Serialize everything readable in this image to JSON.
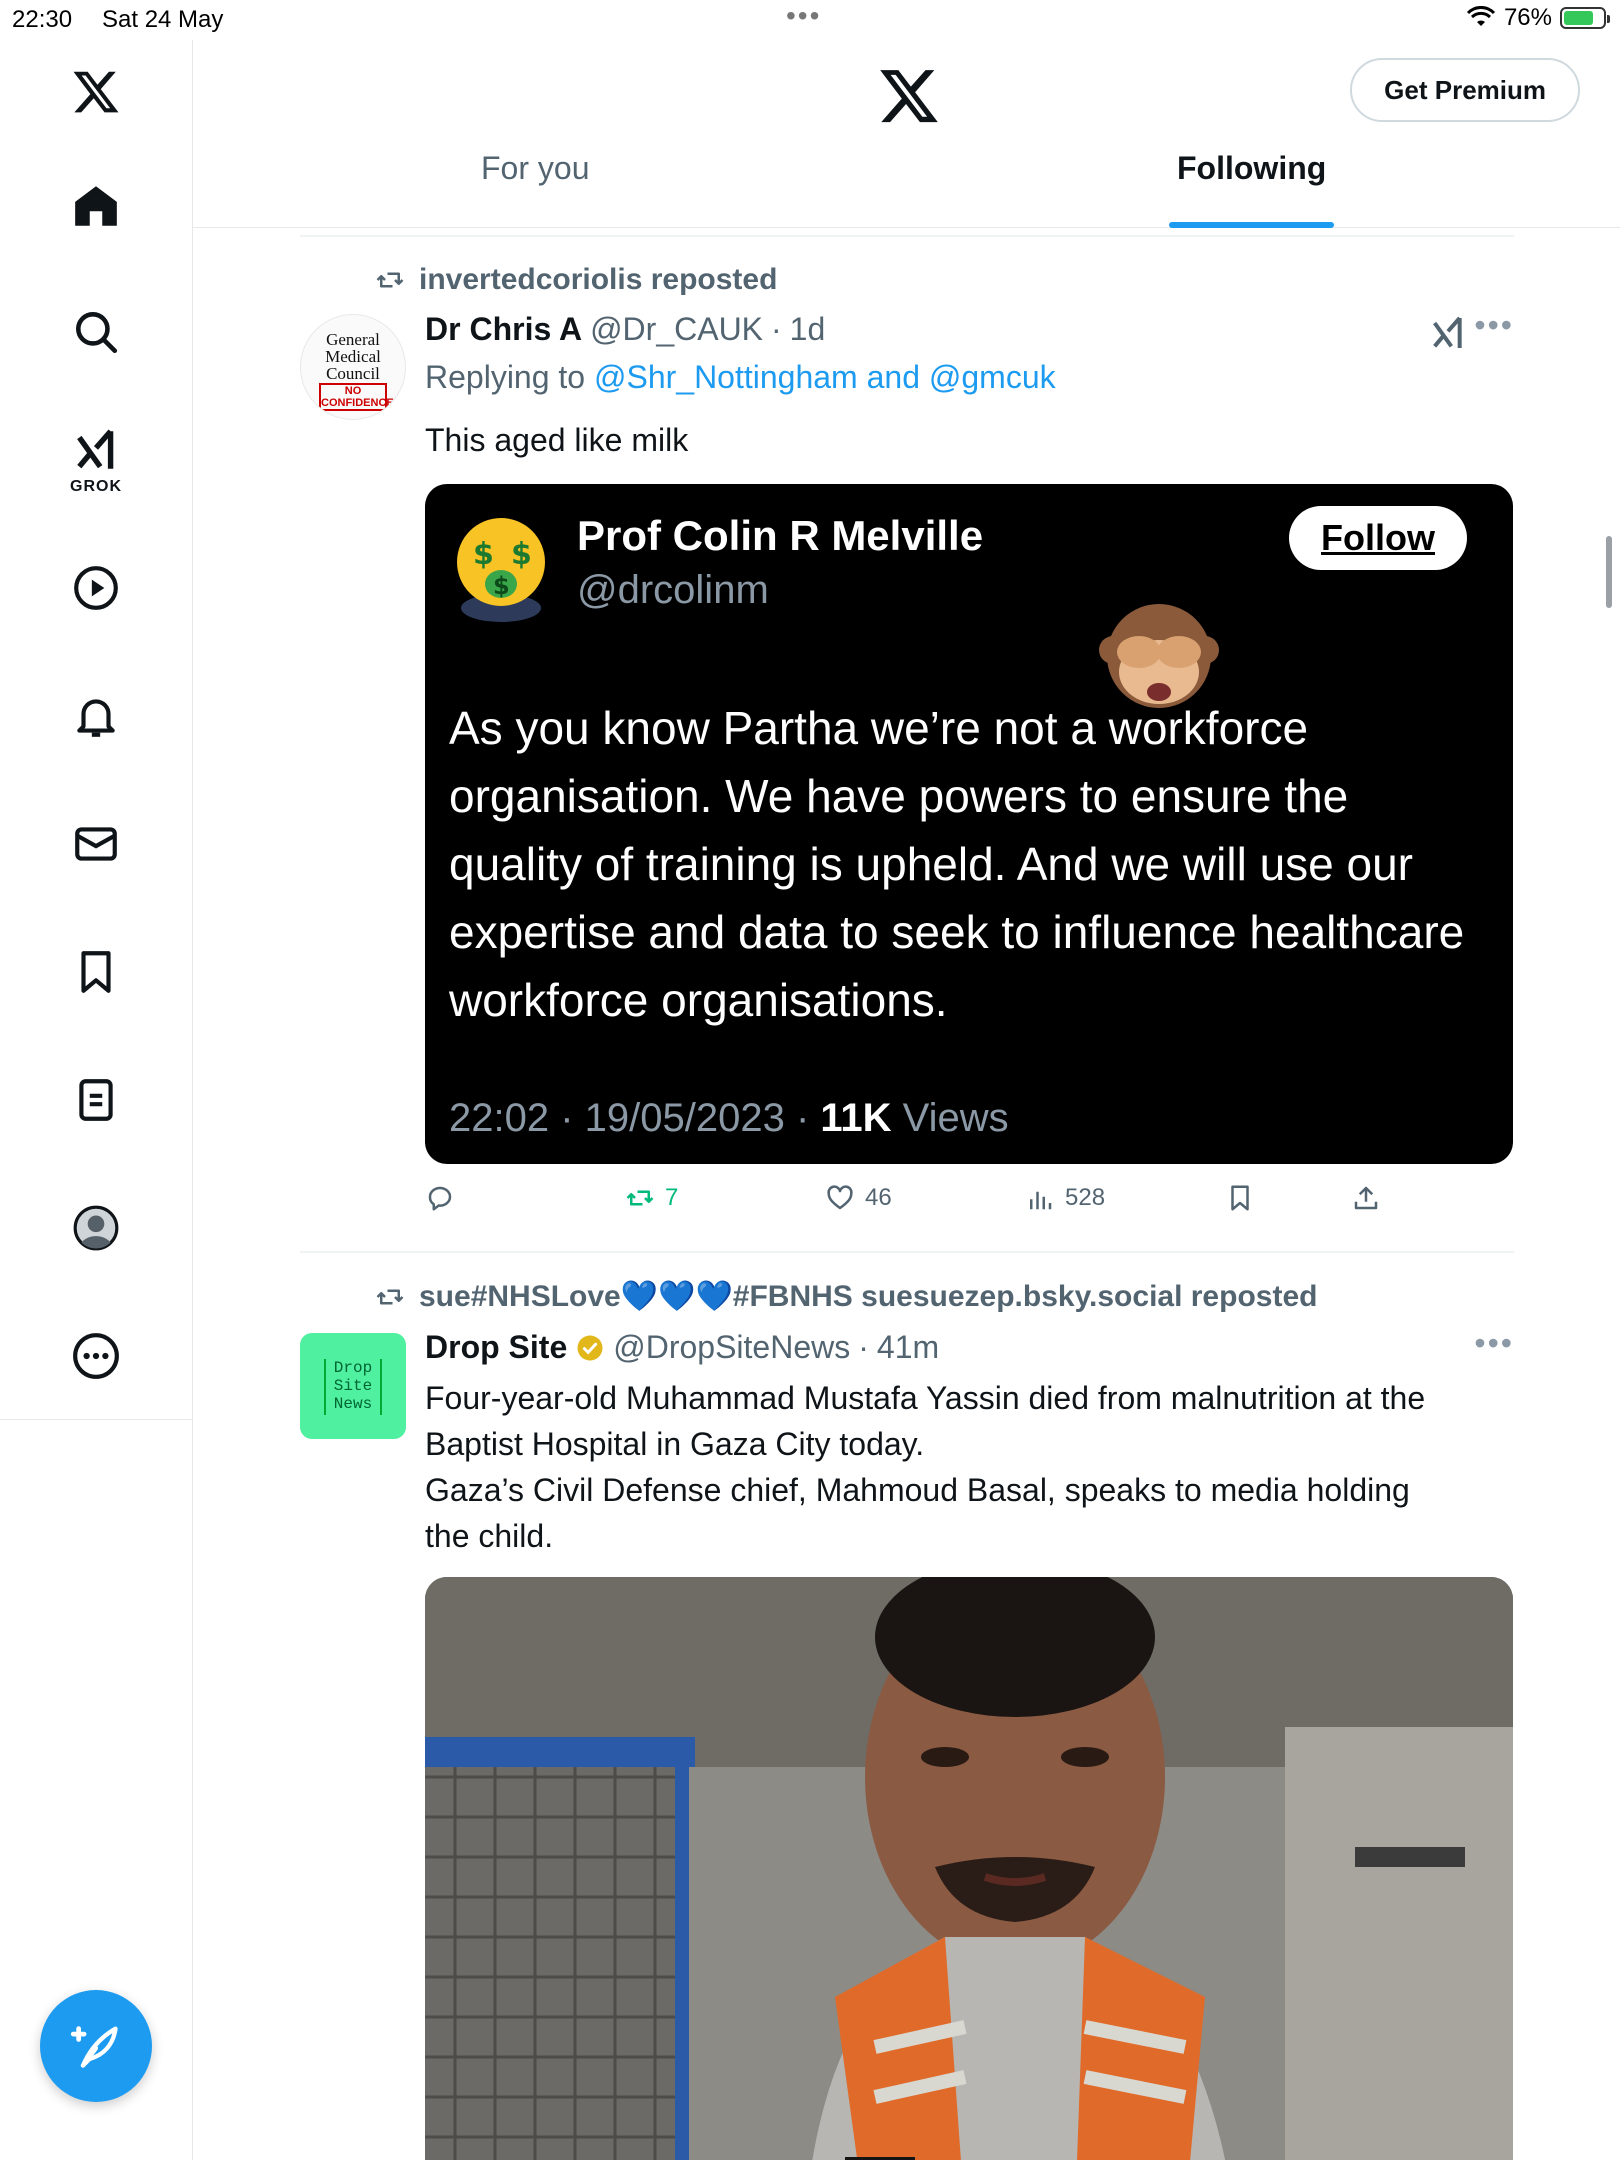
{
  "status_bar": {
    "time": "22:30",
    "date": "Sat 24 May",
    "battery": "76%"
  },
  "header": {
    "premium_label": "Get Premium",
    "tabs": [
      {
        "label": "For you"
      },
      {
        "label": "Following"
      }
    ]
  },
  "sidebar": {
    "grok_label": "GROK"
  },
  "tweets": [
    {
      "repost_by": "invertedcoriolis reposted",
      "avatar_text": [
        "General",
        "Medical",
        "Council",
        "NO",
        "CONFIDENCE"
      ],
      "name": "Dr Chris A",
      "handle": "@Dr_CAUK",
      "time": "1d",
      "replying_prefix": "Replying to",
      "replying_to": "@Shr_Nottingham and @gmcuk",
      "text": "This aged like milk",
      "embedded": {
        "name": "Prof Colin R Melville",
        "handle": "@drcolinm",
        "follow_label": "Follow",
        "body": "As you know Partha we’re not a workforce organisation. We have powers to ensure the quality of training is upheld.  And we will use our expertise and data to seek to influence healthcare workforce organisations.",
        "timestamp": "22:02 · 19/05/2023 · ",
        "views_count": "11K",
        "views_label": " Views"
      },
      "actions": {
        "replies": "",
        "reposts": "7",
        "likes": "46",
        "views": "528"
      }
    },
    {
      "repost_by": "sue#NHSLove💙💙💙#FBNHS suesuezep.bsky.social reposted",
      "avatar_text": [
        "Drop",
        "Site",
        "News"
      ],
      "name": "Drop Site",
      "handle": "@DropSiteNews",
      "time": "41m",
      "text_lines": [
        "Four-year-old Muhammad Mustafa Yassin died from malnutrition at the",
        "Baptist Hospital in Gaza City today.",
        "Gaza’s Civil Defense chief, Mahmoud Basal, speaks to media holding",
        "the child."
      ]
    }
  ],
  "colors": {
    "accent": "#1d9bf0",
    "repost_green": "#00ba7c",
    "muted": "#536471",
    "dropsite_green": "#4ff0a0"
  }
}
